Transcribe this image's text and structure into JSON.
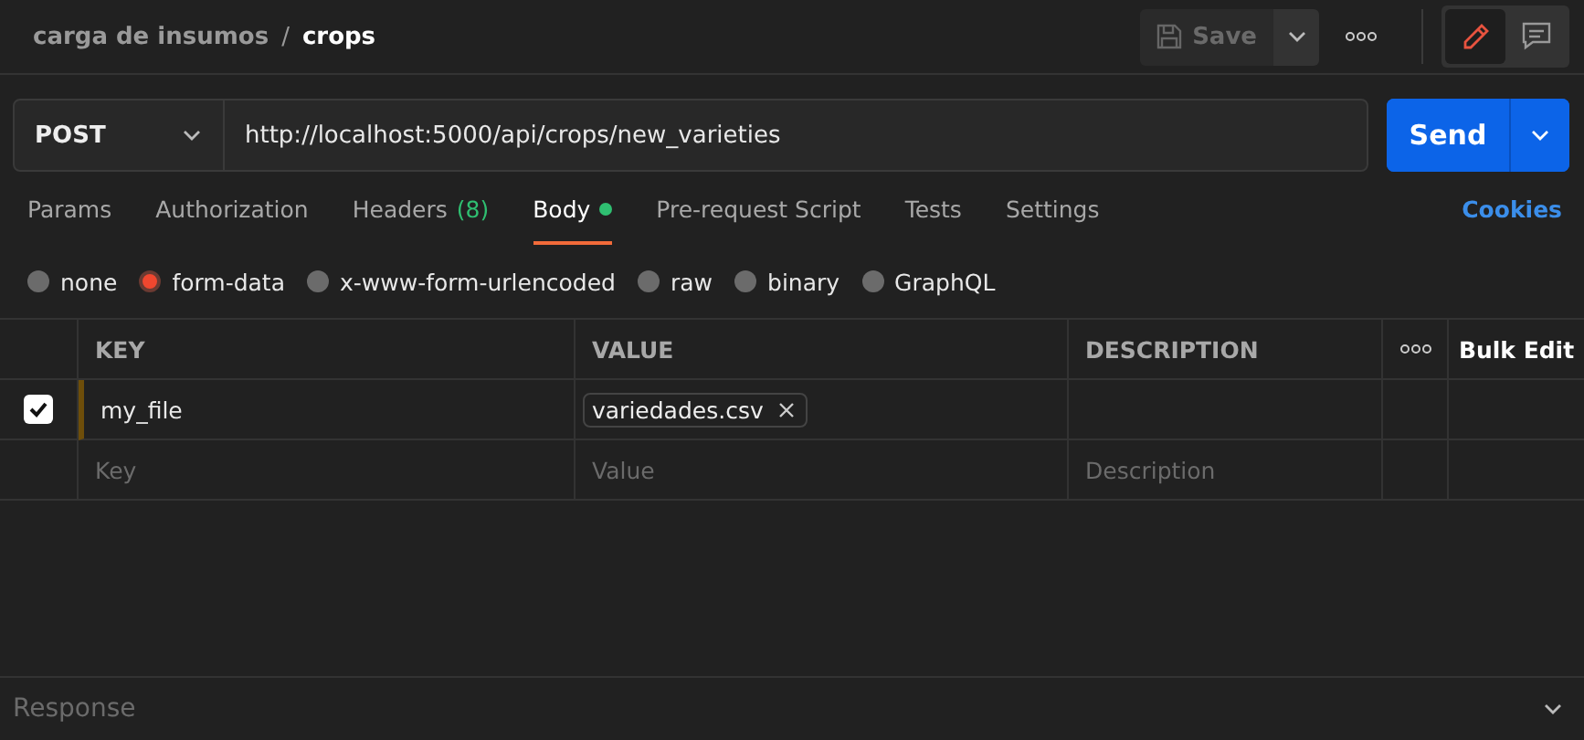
{
  "breadcrumb": {
    "parent": "carga de insumos",
    "separator": "/",
    "current": "crops"
  },
  "toolbar": {
    "save": "Save",
    "edit_mode": true
  },
  "request": {
    "method": "POST",
    "url": "http://localhost:5000/api/crops/new_varieties",
    "send": "Send"
  },
  "tabs": [
    {
      "label": "Params",
      "selected": false
    },
    {
      "label": "Authorization",
      "selected": false
    },
    {
      "label": "Headers",
      "count": "(8)",
      "selected": false
    },
    {
      "label": "Body",
      "dot": true,
      "selected": true
    },
    {
      "label": "Pre-request Script",
      "selected": false
    },
    {
      "label": "Tests",
      "selected": false
    },
    {
      "label": "Settings",
      "selected": false
    }
  ],
  "cookies": "Cookies",
  "body_types": [
    {
      "label": "none",
      "selected": false
    },
    {
      "label": "form-data",
      "selected": true
    },
    {
      "label": "x-www-form-urlencoded",
      "selected": false
    },
    {
      "label": "raw",
      "selected": false
    },
    {
      "label": "binary",
      "selected": false
    },
    {
      "label": "GraphQL",
      "selected": false
    }
  ],
  "table": {
    "columns": [
      "KEY",
      "VALUE",
      "DESCRIPTION"
    ],
    "bulk_edit": "Bulk Edit",
    "rows": [
      {
        "checked": true,
        "key": "my_file",
        "file": "variedades.csv"
      }
    ],
    "new_row": {
      "key_placeholder": "Key",
      "value_placeholder": "Value",
      "description_placeholder": "Description"
    }
  },
  "response": {
    "label": "Response"
  }
}
